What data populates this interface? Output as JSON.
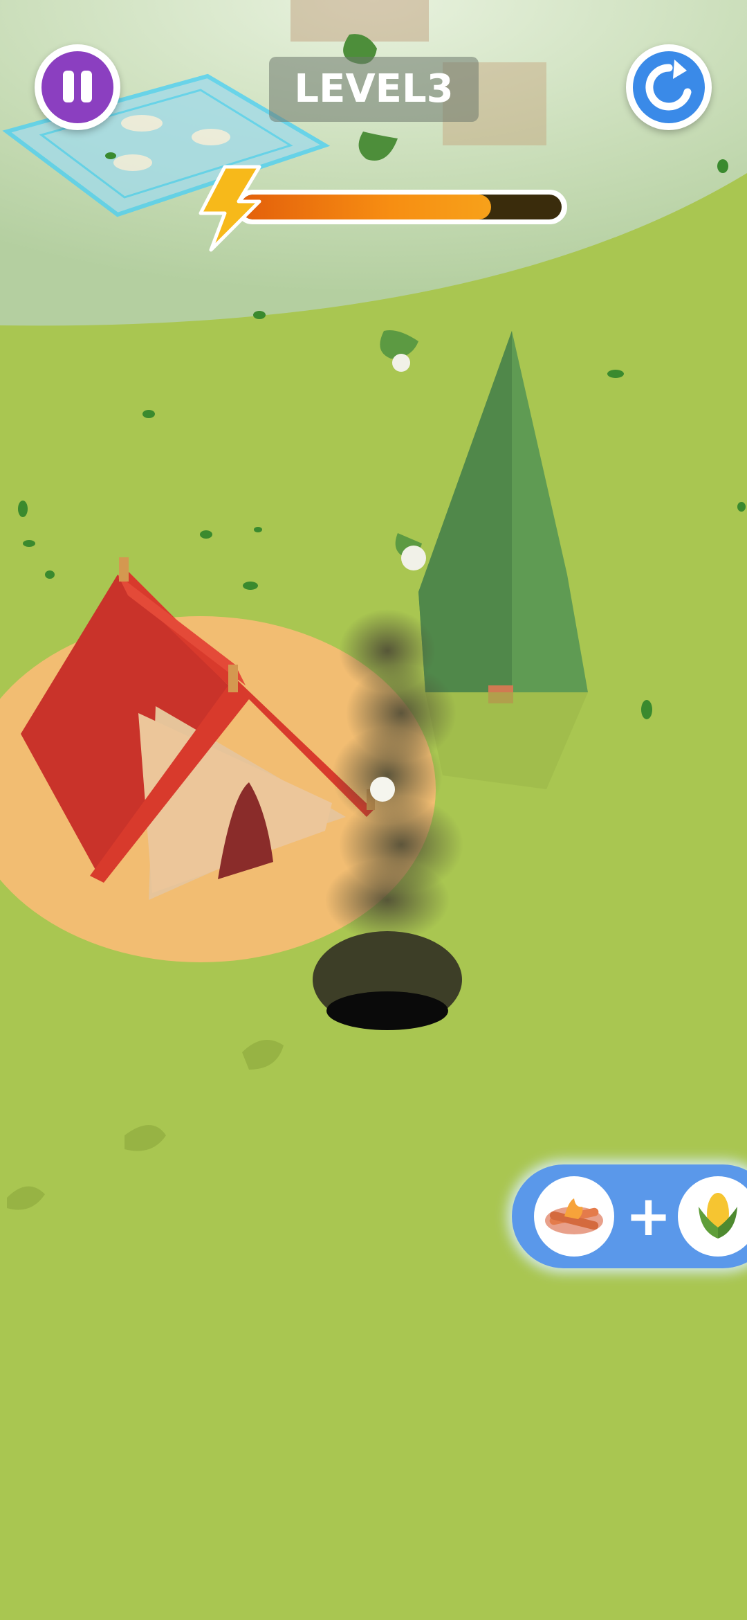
{
  "hud": {
    "level_label": "LEVEL3",
    "pause_icon": "pause-icon",
    "restart_icon": "restart-icon",
    "energy_icon": "lightning-bolt-icon",
    "energy_fraction": 0.78
  },
  "goal": {
    "items": [
      "campfire-icon",
      "corn-icon"
    ],
    "separator": "+"
  },
  "colors": {
    "pause_button": "#8b3fc0",
    "restart_button": "#3a8ae8",
    "energy_fill": "#f78e12",
    "goal_panel": "#5a98ea",
    "grass": "#a9c651",
    "tent": "#d83a2c"
  }
}
